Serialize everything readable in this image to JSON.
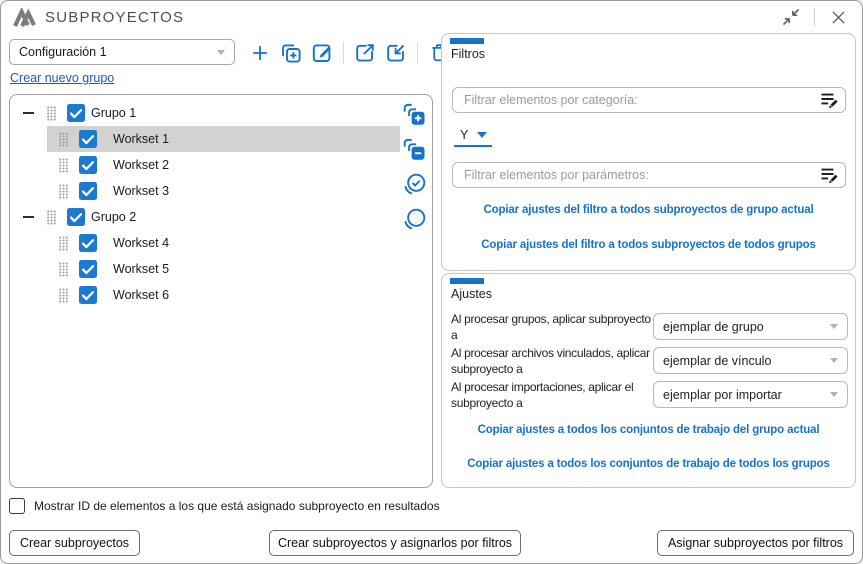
{
  "title_bar": {
    "title": "SUBPROYECTOS"
  },
  "toolbar": {
    "config_select_value": "Configuración 1",
    "create_group_link": "Crear nuevo grupo"
  },
  "tree": {
    "items": [
      {
        "label": "Grupo 1",
        "group": true,
        "checked": true,
        "selected": false
      },
      {
        "label": "Workset 1",
        "group": false,
        "checked": true,
        "selected": true
      },
      {
        "label": "Workset 2",
        "group": false,
        "checked": true,
        "selected": false
      },
      {
        "label": "Workset 3",
        "group": false,
        "checked": true,
        "selected": false
      },
      {
        "label": "Grupo 2",
        "group": true,
        "checked": true,
        "selected": false
      },
      {
        "label": "Workset 4",
        "group": false,
        "checked": true,
        "selected": false
      },
      {
        "label": "Workset 5",
        "group": false,
        "checked": true,
        "selected": false
      },
      {
        "label": "Workset 6",
        "group": false,
        "checked": true,
        "selected": false
      }
    ]
  },
  "filters": {
    "tab_label": "Filtros",
    "category_placeholder": "Filtrar elementos por categoría:",
    "operator_value": "Y",
    "params_placeholder": "Filtrar elementos por parámetros:",
    "copy_links": [
      "Copiar ajustes del filtro a todos subproyectos de grupo actual",
      "Copiar ajustes del filtro a todos subproyectos de todos grupos"
    ]
  },
  "settings": {
    "tab_label": "Ajustes",
    "rows": [
      {
        "label": "Al procesar grupos, aplicar subproyecto a",
        "value": "ejemplar de grupo"
      },
      {
        "label": "Al procesar archivos vinculados, aplicar subproyecto a",
        "value": "ejemplar de vínculo"
      },
      {
        "label": "Al procesar importaciones, aplicar el subproyecto a",
        "value": "ejemplar por importar"
      }
    ],
    "copy_links": [
      "Copiar ajustes a todos los conjuntos de trabajo del grupo actual",
      "Copiar ajustes a todos los conjuntos de trabajo de todos los grupos"
    ]
  },
  "footer": {
    "show_id_label": "Mostrar ID de elementos a los que está asignado subproyecto en resultados",
    "show_id_checked": false,
    "buttons": [
      "Crear subproyectos",
      "Crear subproyectos y asignarlos por filtros",
      "Asignar subproyectos por filtros"
    ]
  },
  "icons": {
    "titlebar": [
      "app-logo-icon",
      "collapse-window-icon",
      "close-icon"
    ],
    "toolbar": [
      "plus-icon",
      "duplicate-icon",
      "edit-icon",
      "export-icon",
      "import-icon",
      "trash-icon"
    ],
    "tree": [
      "drag-handle-icon",
      "collapse-toggle-icon",
      "checkbox-checked-icon",
      "stack-plus-icon",
      "stack-minus-icon",
      "circle-check-icon",
      "circle-outline-icon"
    ],
    "inputs": [
      "edit-filter-icon",
      "chevron-down-icon"
    ]
  },
  "colors": {
    "accent": "#1673c7",
    "hyperlink": "#2353cc",
    "checkbox": "#1c79d2",
    "selection": "#d2d2d2",
    "title_text": "#4f4f4f"
  }
}
